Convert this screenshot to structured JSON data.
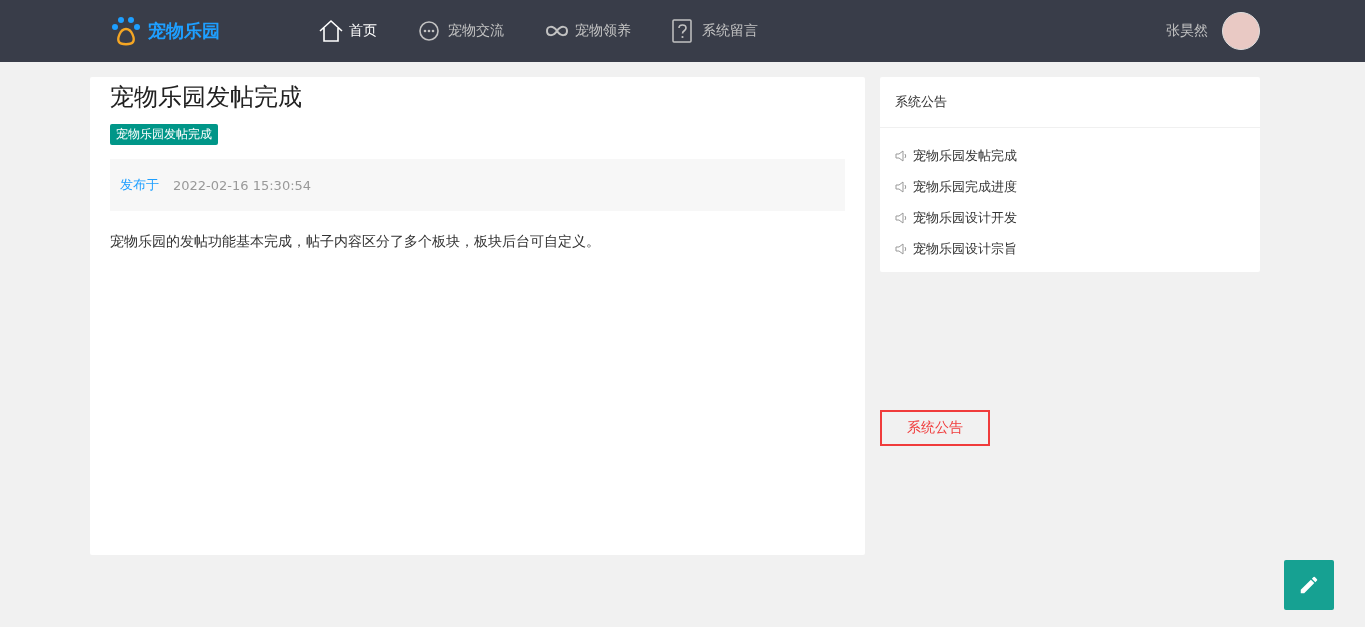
{
  "logo": {
    "text": "宠物乐园"
  },
  "nav": [
    {
      "label": "首页",
      "selected": true
    },
    {
      "label": "宠物交流",
      "selected": false
    },
    {
      "label": "宠物领养",
      "selected": false
    },
    {
      "label": "系统留言",
      "selected": false
    }
  ],
  "user": {
    "name": "张昊然"
  },
  "post": {
    "title": "宠物乐园发帖完成",
    "tag": "宠物乐园发帖完成",
    "published_label": "发布于",
    "published_time": "2022-02-16 15:30:54",
    "body": "宠物乐园的发帖功能基本完成，帖子内容区分了多个板块，板块后台可自定义。"
  },
  "notice": {
    "title": "系统公告",
    "items": [
      "宠物乐园发帖完成",
      "宠物乐园完成进度",
      "宠物乐园设计开发",
      "宠物乐园设计宗旨"
    ]
  },
  "boxed_label": "系统公告"
}
